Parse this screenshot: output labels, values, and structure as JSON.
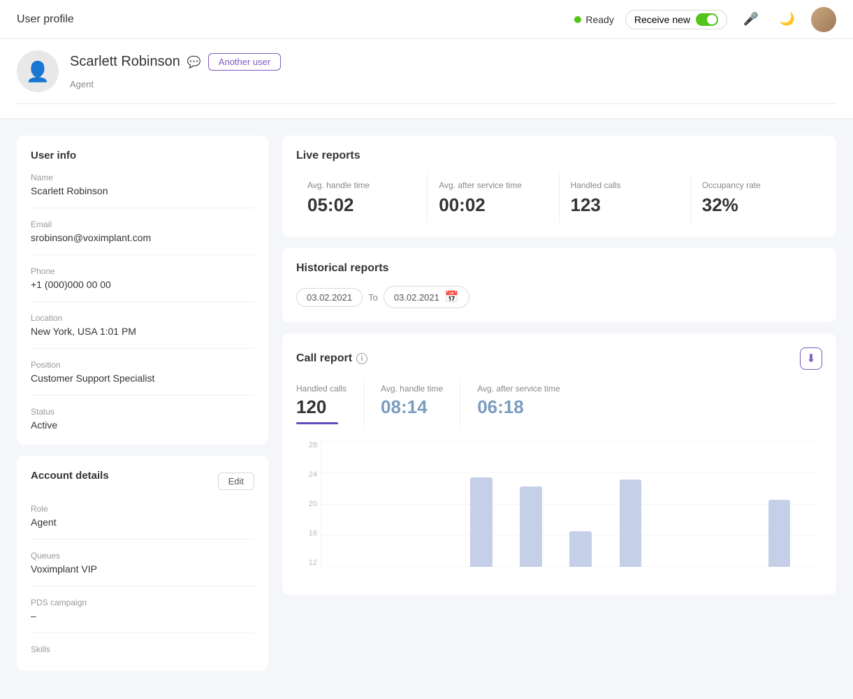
{
  "header": {
    "title": "User profile",
    "status": {
      "label": "Ready",
      "dot_color": "#52c41a"
    },
    "receive_new": {
      "label": "Receive new",
      "toggle_on": true
    },
    "icons": {
      "mic": "🎤",
      "moon": "🌙"
    }
  },
  "profile": {
    "name": "Scarlett Robinson",
    "role": "Agent",
    "another_user_label": "Another user"
  },
  "user_info": {
    "title": "User info",
    "fields": [
      {
        "label": "Name",
        "value": "Scarlett Robinson"
      },
      {
        "label": "Email",
        "value": "srobinson@voximplant.com"
      },
      {
        "label": "Phone",
        "value": "+1 (000)000 00 00"
      },
      {
        "label": "Location",
        "value": "New York, USA 1:01 PM"
      },
      {
        "label": "Position",
        "value": "Customer Support Specialist"
      },
      {
        "label": "Status",
        "value": "Active"
      }
    ]
  },
  "account_details": {
    "title": "Account details",
    "edit_label": "Edit",
    "fields": [
      {
        "label": "Role",
        "value": "Agent"
      },
      {
        "label": "Queues",
        "value": "Voximplant VIP"
      },
      {
        "label": "PDS campaign",
        "value": "–"
      },
      {
        "label": "Skills",
        "value": ""
      }
    ]
  },
  "live_reports": {
    "title": "Live reports",
    "metrics": [
      {
        "label": "Avg. handle time",
        "value": "05:02"
      },
      {
        "label": "Avg. after service time",
        "value": "00:02"
      },
      {
        "label": "Handled calls",
        "value": "123"
      },
      {
        "label": "Occupancy rate",
        "value": "32%"
      }
    ]
  },
  "historical_reports": {
    "title": "Historical reports",
    "date_from": "03.02.2021",
    "date_to_label": "To",
    "date_to": "03.02.2021"
  },
  "call_report": {
    "title": "Call report",
    "metrics": [
      {
        "label": "Handled calls",
        "value": "120",
        "color": "dark",
        "underline": true
      },
      {
        "label": "Avg. handle time",
        "value": "08:14",
        "color": "blue",
        "underline": false
      },
      {
        "label": "Avg. after service time",
        "value": "06:18",
        "color": "blue",
        "underline": false
      }
    ],
    "chart": {
      "y_labels": [
        "28",
        "24",
        "20",
        "16",
        "12"
      ],
      "bars": [
        0,
        0,
        0,
        0,
        0,
        0,
        0.8,
        0,
        0.72,
        0,
        0.32,
        0,
        0.78,
        0,
        0,
        0,
        0,
        0,
        0.6,
        0
      ]
    }
  }
}
